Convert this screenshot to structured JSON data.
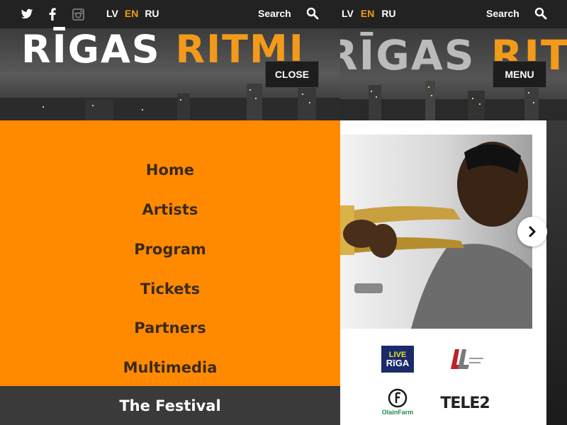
{
  "topbar": {
    "languages": [
      "LV",
      "EN",
      "RU"
    ],
    "active_language": "EN",
    "search_label": "Search"
  },
  "logo": {
    "part1": "RĪGAS",
    "part2": "RITMI"
  },
  "header": {
    "close_label": "CLOSE",
    "menu_label": "MENU"
  },
  "menu": {
    "items": [
      "Home",
      "Artists",
      "Program",
      "Tickets",
      "Partners",
      "Multimedia"
    ],
    "festival_label": "The Festival"
  },
  "partners": {
    "live_riga_line1": "LIVE",
    "live_riga_line2": "RīGA",
    "tele2": "TELE2",
    "olainfarm": "OlainFarm"
  },
  "colors": {
    "accent": "#ff8a00",
    "dark": "#222222",
    "menu_text": "#3b2a19"
  }
}
